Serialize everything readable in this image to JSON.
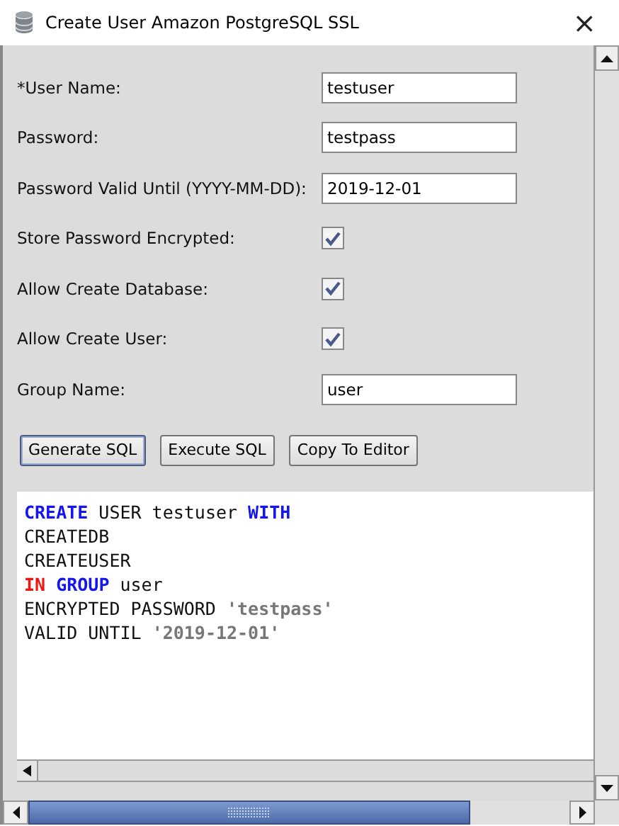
{
  "window": {
    "title": "Create User Amazon PostgreSQL SSL",
    "close": "×"
  },
  "fields": [
    {
      "kind": "text",
      "label": "*User Name:",
      "value": "testuser"
    },
    {
      "kind": "text",
      "label": "Password:",
      "value": "testpass"
    },
    {
      "kind": "text",
      "label": "Password Valid Until (YYYY-MM-DD):",
      "value": "2019-12-01"
    },
    {
      "kind": "checkbox",
      "label": "Store Password Encrypted:",
      "checked": true
    },
    {
      "kind": "checkbox",
      "label": "Allow Create Database:",
      "checked": true
    },
    {
      "kind": "checkbox",
      "label": "Allow Create User:",
      "checked": true
    },
    {
      "kind": "text",
      "label": "Group Name:",
      "value": "user"
    }
  ],
  "buttons": [
    {
      "label": "Generate SQL",
      "focused": true
    },
    {
      "label": "Execute SQL",
      "focused": false
    },
    {
      "label": "Copy To Editor",
      "focused": false
    }
  ],
  "sql_lines": [
    {
      "tokens": [
        {
          "kind": "keyword",
          "text": "CREATE"
        },
        {
          "kind": "plain",
          "text": " USER testuser "
        },
        {
          "kind": "keyword",
          "text": "WITH"
        }
      ]
    },
    {
      "tokens": [
        {
          "kind": "plain",
          "text": "CREATEDB"
        }
      ]
    },
    {
      "tokens": [
        {
          "kind": "plain",
          "text": "CREATEUSER"
        }
      ]
    },
    {
      "tokens": [
        {
          "kind": "operator",
          "text": "IN"
        },
        {
          "kind": "keyword",
          "text": " GROUP"
        },
        {
          "kind": "plain",
          "text": " user"
        }
      ]
    },
    {
      "tokens": [
        {
          "kind": "plain",
          "text": "ENCRYPTED PASSWORD "
        },
        {
          "kind": "string",
          "text": "'testpass'"
        }
      ]
    },
    {
      "tokens": [
        {
          "kind": "plain",
          "text": "VALID UNTIL "
        },
        {
          "kind": "string",
          "text": "'2019-12-01'"
        }
      ]
    }
  ]
}
